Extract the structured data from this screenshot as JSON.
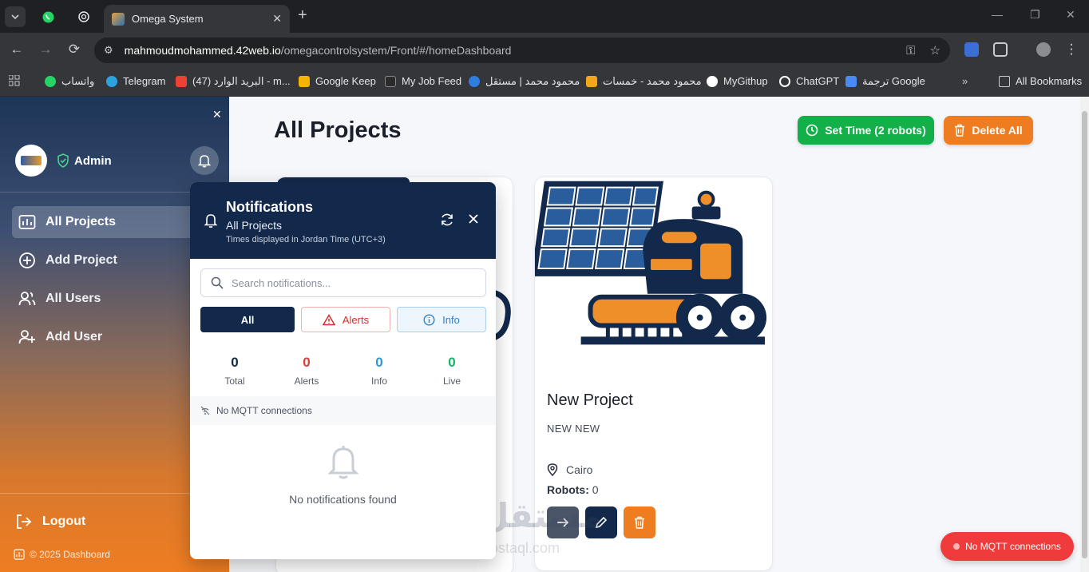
{
  "browser": {
    "tab_title": "Omega System",
    "url_host": "mahmoudmohammed.42web.io",
    "url_path": "/omegacontrolsystem/Front/#/homeDashboard",
    "bookmarks": [
      {
        "label": "واتساب",
        "color": "#25d366"
      },
      {
        "label": "Telegram",
        "color": "#2aa3de"
      },
      {
        "label": "البريد الوارد (47) - m...",
        "color": "#ea4335"
      },
      {
        "label": "Google Keep",
        "color": "#f6b400"
      },
      {
        "label": "My Job Feed",
        "color": "#2b2b2b"
      },
      {
        "label": "محمود محمد | مستقل",
        "color": "#2f7de1"
      },
      {
        "label": "محمود محمد - خمسات",
        "color": "#f3a51c"
      },
      {
        "label": "MyGithup",
        "color": "#ffffff"
      },
      {
        "label": "ChatGPT",
        "color": "#ffffff"
      },
      {
        "label": "ترجمة Google",
        "color": "#4a8af4"
      }
    ],
    "all_bookmarks": "All Bookmarks"
  },
  "sidebar": {
    "role": "Admin",
    "items": [
      {
        "label": "All Projects",
        "icon": "projects-icon"
      },
      {
        "label": "Add Project",
        "icon": "plus-circle-icon"
      },
      {
        "label": "All Users",
        "icon": "users-icon"
      },
      {
        "label": "Add User",
        "icon": "add-user-icon"
      }
    ],
    "logout": "Logout",
    "copyright": "© 2025 Dashboard"
  },
  "main": {
    "title": "All Projects",
    "set_time_label": "Set Time (2 robots)",
    "delete_all_label": "Delete All",
    "project": {
      "name": "New Project",
      "description": "NEW NEW",
      "location": "Cairo",
      "robots_label": "Robots:",
      "robots_count": "0"
    },
    "toast": "No MQTT connections"
  },
  "watermark": {
    "line1": "مستقل",
    "line2": "mostaql.com"
  },
  "notifications": {
    "title": "Notifications",
    "subtitle": "All Projects",
    "timezone": "Times displayed in Jordan Time (UTC+3)",
    "search_placeholder": "Search notifications...",
    "filters": {
      "all": "All",
      "alerts": "Alerts",
      "info": "Info"
    },
    "stats": [
      {
        "value": "0",
        "label": "Total",
        "color": "#13294b"
      },
      {
        "value": "0",
        "label": "Alerts",
        "color": "#e03a3a"
      },
      {
        "value": "0",
        "label": "Info",
        "color": "#2f97d8"
      },
      {
        "value": "0",
        "label": "Live",
        "color": "#16b36b"
      }
    ],
    "mqtt_status": "No MQTT connections",
    "empty_text": "No notifications found"
  }
}
